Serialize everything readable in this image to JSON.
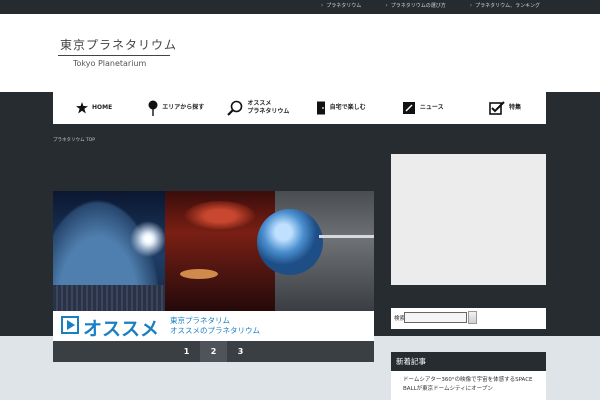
{
  "top_links": [
    "プラネタリウム",
    "プラネタリウムの選び方",
    "プラネタリウム、ランキング"
  ],
  "logo": {
    "jp": "東京プラネタリウム",
    "en": "Tokyo Planetarium"
  },
  "nav": [
    {
      "label": "HOME",
      "icon": "star-icon"
    },
    {
      "label": "エリアから探す",
      "icon": "pin-icon"
    },
    {
      "label": "オススメ\nプラネタリウム",
      "icon": "magnifier-icon"
    },
    {
      "label": "自宅で楽しむ",
      "icon": "door-icon"
    },
    {
      "label": "ニュース",
      "icon": "pencil-icon"
    },
    {
      "label": "特集",
      "icon": "checkbox-icon"
    }
  ],
  "breadcrumb": "プラネタリウム TOP",
  "banner": {
    "big": "オススメ",
    "small": "東京プラネタリム\nオススメのプラネタリウム",
    "accent": "#1a7fc1"
  },
  "pager": {
    "pages": [
      "1",
      "2",
      "3"
    ],
    "active": "2"
  },
  "search": {
    "label": "検索",
    "value": ""
  },
  "widget": {
    "title": "新着記事",
    "text": "ドームシアター360°の映像で宇宙を体感するSPACE BALLが東京ドームシティにオープン"
  },
  "colors": {
    "dark": "#272c30",
    "page_bg": "#dfe4e8",
    "accent": "#1a7fc1"
  }
}
